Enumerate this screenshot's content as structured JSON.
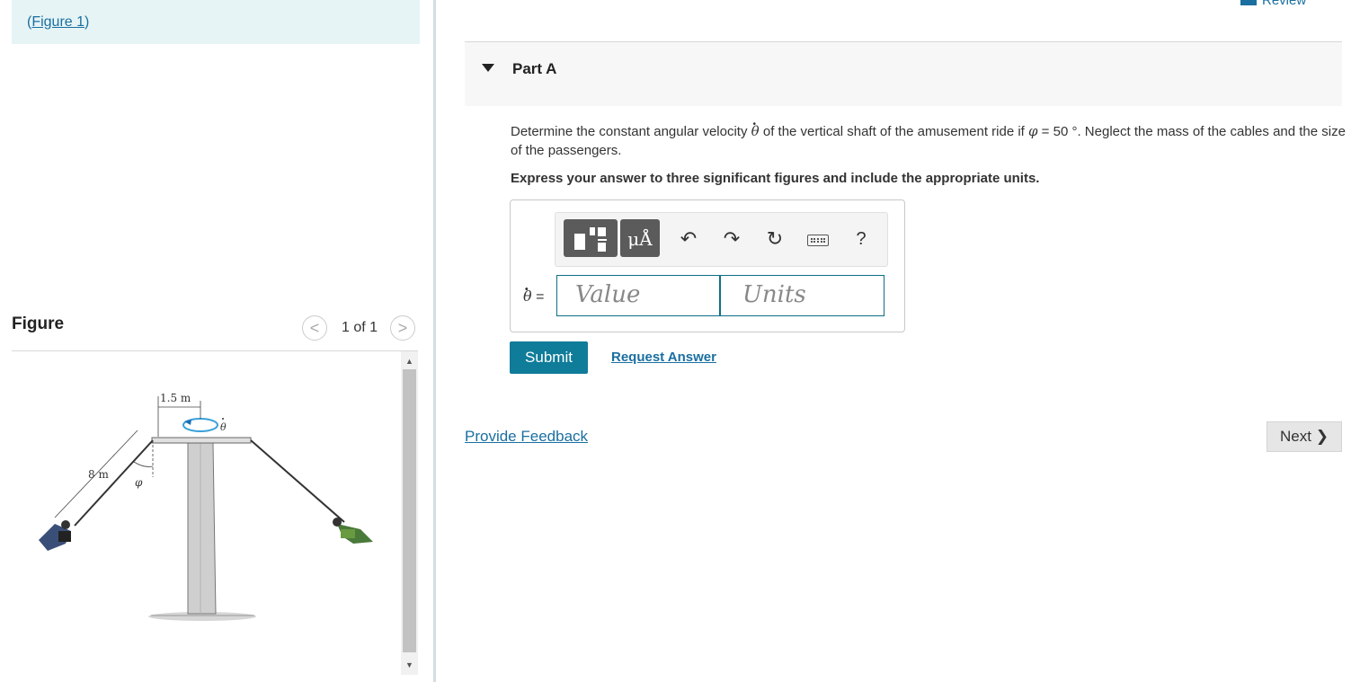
{
  "left": {
    "figure_link": {
      "open": "(",
      "label": "Figure 1",
      "close": ")"
    },
    "figure_title": "Figure",
    "pager": {
      "prev": "<",
      "count": "1 of 1",
      "next": ">"
    },
    "figure_labels": {
      "top_dim": "1.5 m",
      "cable": "8 m",
      "angle": "φ",
      "rate": "θ"
    }
  },
  "right": {
    "review_link": "Review",
    "part_label": "Part A",
    "question": {
      "pre": "Determine the constant angular velocity ",
      "sym": "θ",
      "mid": " of the vertical shaft of the amusement ride if ",
      "phi": "φ",
      "post": " = 50 °. Neglect the mass of the cables and the size of the passengers."
    },
    "instructions": "Express your answer to three significant figures and include the appropriate units.",
    "toolbar": {
      "units_button": "μÅ",
      "undo": "↶",
      "redo": "↷",
      "reset": "↻",
      "help": "?"
    },
    "answer": {
      "variable": "θ",
      "equals": " =",
      "value_placeholder": "Value",
      "units_placeholder": "Units"
    },
    "submit_label": "Submit",
    "request_answer_label": "Request Answer",
    "feedback_label": "Provide Feedback",
    "next_label": "Next",
    "next_arrow": "❯"
  }
}
